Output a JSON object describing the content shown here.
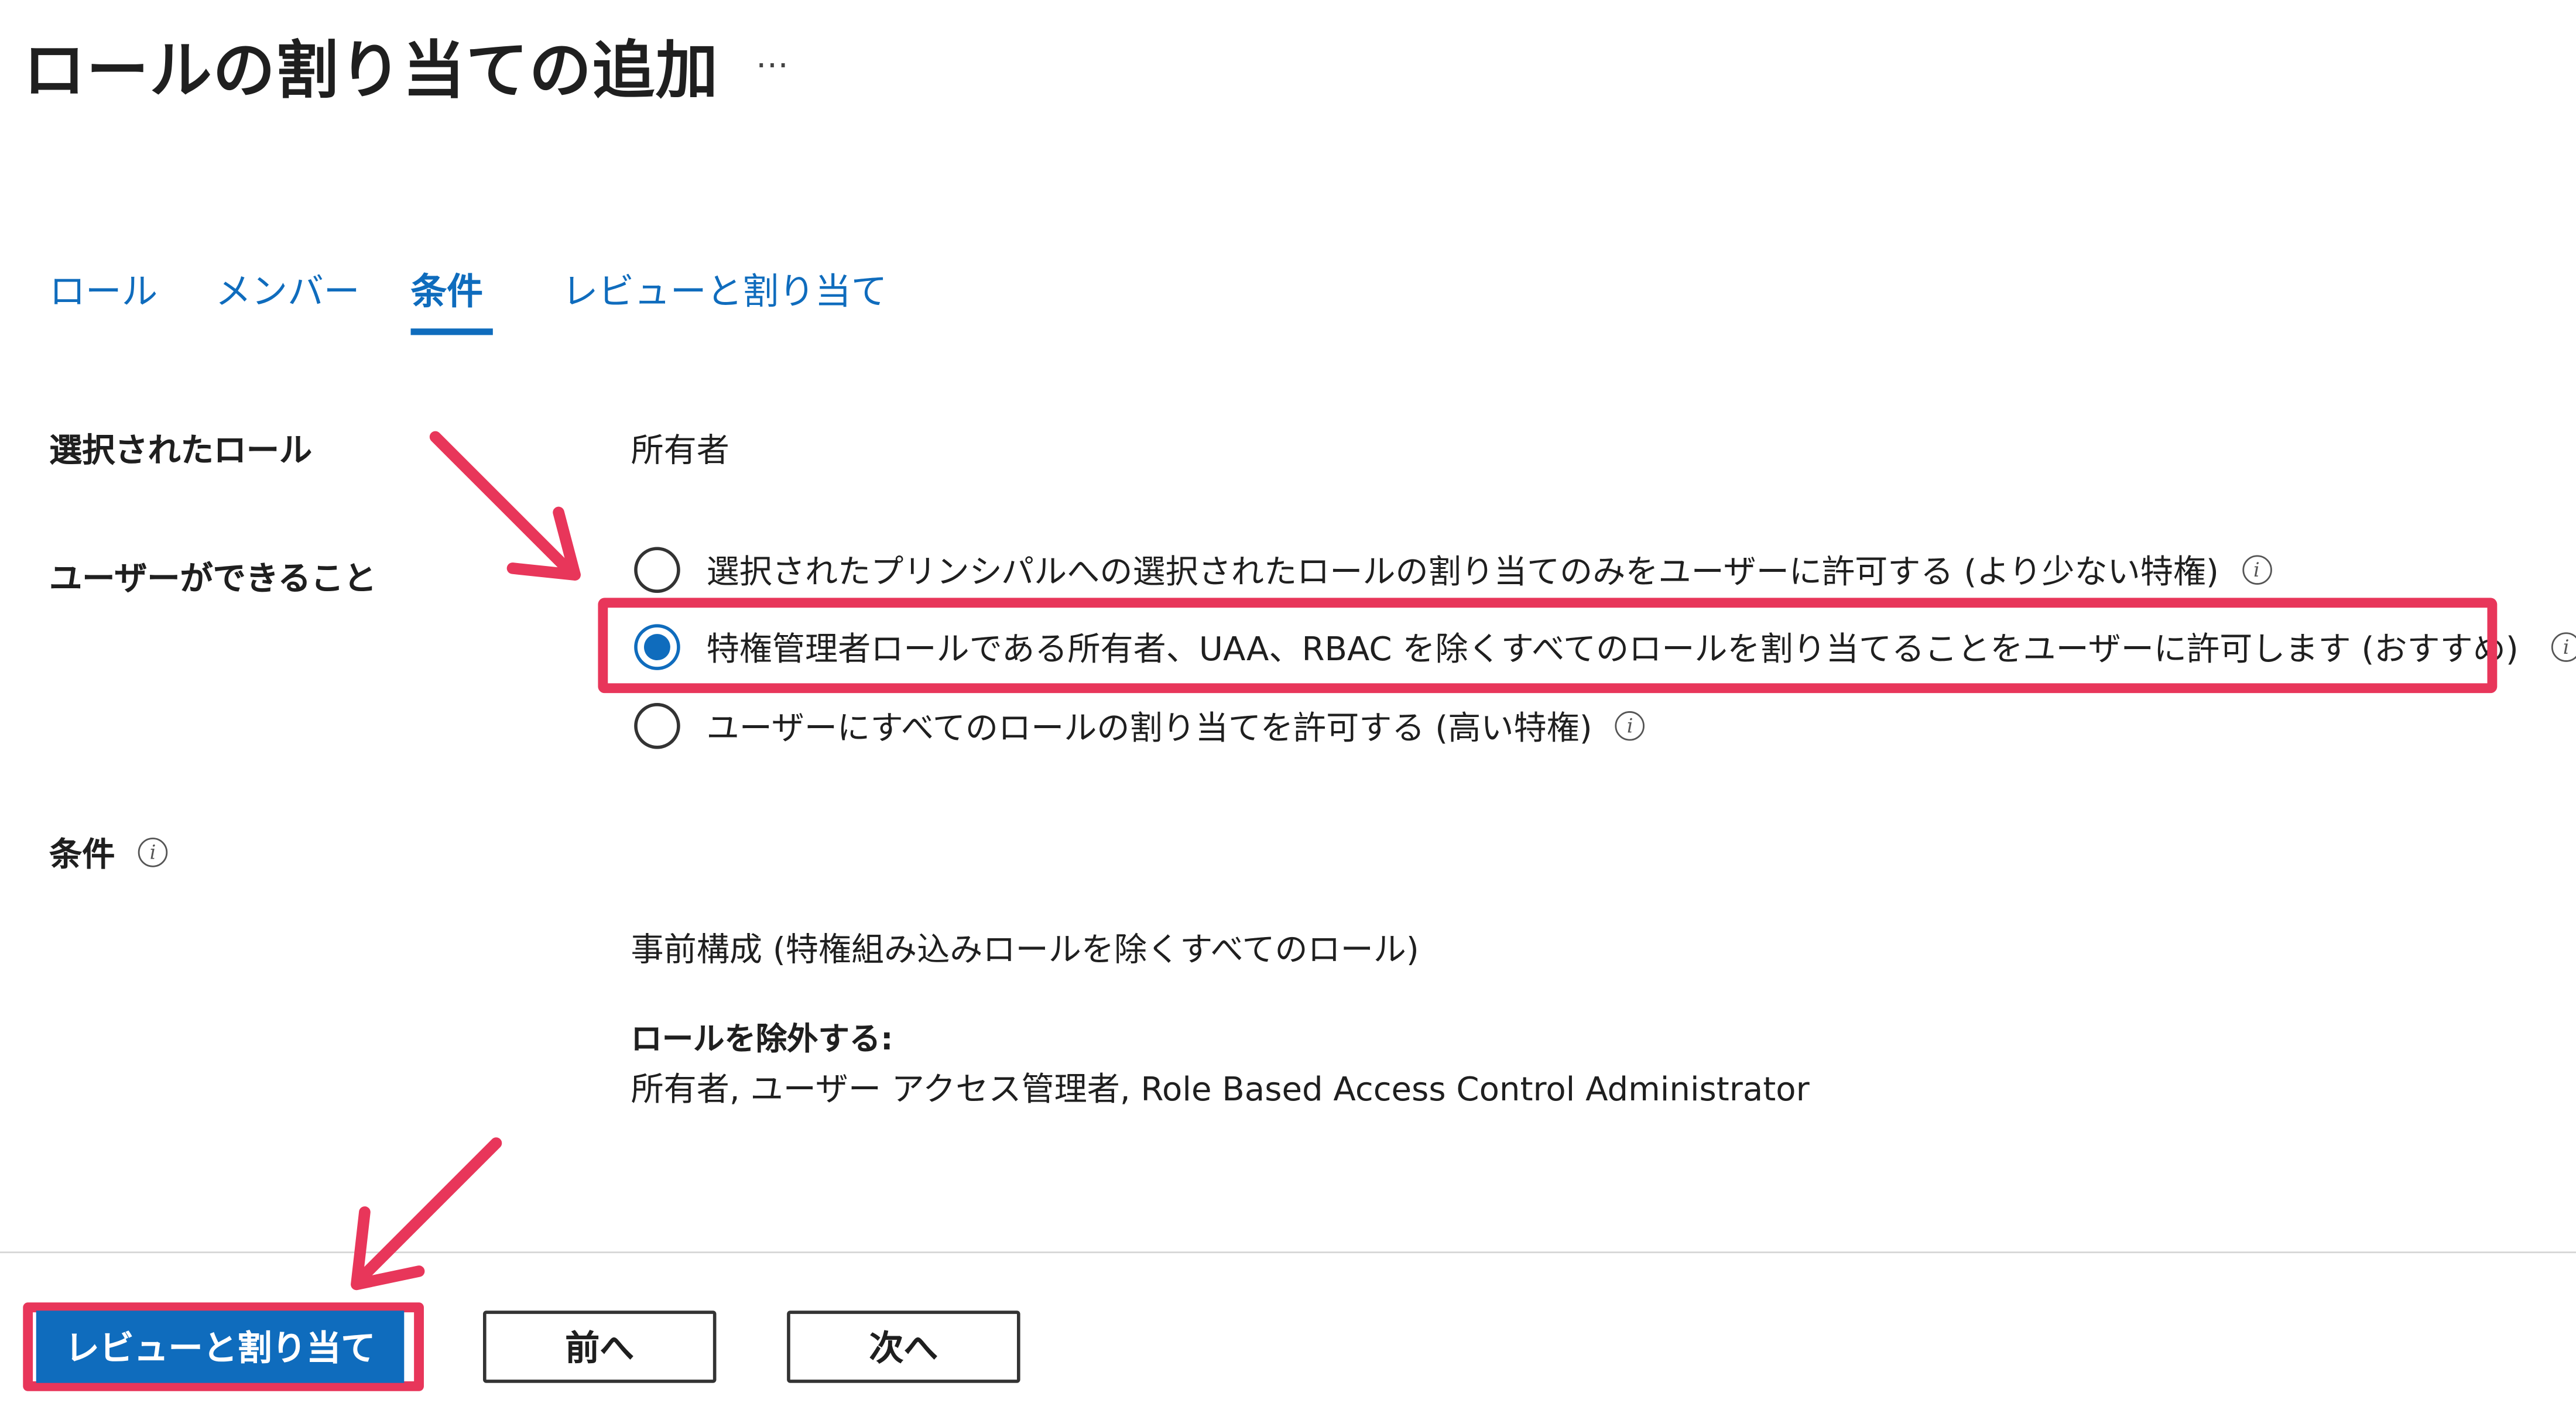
{
  "page": {
    "title": "ロールの割り当ての追加",
    "more_label": "…"
  },
  "tabs": [
    {
      "label": "ロール",
      "active": false
    },
    {
      "label": "メンバー",
      "active": false
    },
    {
      "label": "条件",
      "active": true
    },
    {
      "label": "レビューと割り当て",
      "active": false
    }
  ],
  "selected_role": {
    "label": "選択されたロール",
    "value": "所有者"
  },
  "user_can": {
    "label": "ユーザーができること",
    "options": [
      {
        "text": "選択されたプリンシパルへの選択されたロールの割り当てのみをユーザーに許可する (より少ない特権)",
        "checked": false
      },
      {
        "text": "特権管理者ロールである所有者、UAA、RBAC を除くすべてのロールを割り当てることをユーザーに許可します (おすすめ)",
        "checked": true
      },
      {
        "text": "ユーザーにすべてのロールの割り当てを許可する (高い特権)",
        "checked": false
      }
    ]
  },
  "conditions": {
    "label": "条件",
    "preconfig": "事前構成 (特権組み込みロールを除くすべてのロール)",
    "exclude_label": "ロールを除外する:",
    "exclude_value": "所有者, ユーザー アクセス管理者, Role Based Access Control Administrator"
  },
  "footer": {
    "review_button": "レビューと割り当て",
    "prev_button": "前へ",
    "next_button": "次へ"
  },
  "colors": {
    "accent": "#0f6cbd",
    "annotation": "#e8365a"
  },
  "icons": {
    "info": "info-circle-icon",
    "annotation_arrow": "arrow-icon"
  }
}
